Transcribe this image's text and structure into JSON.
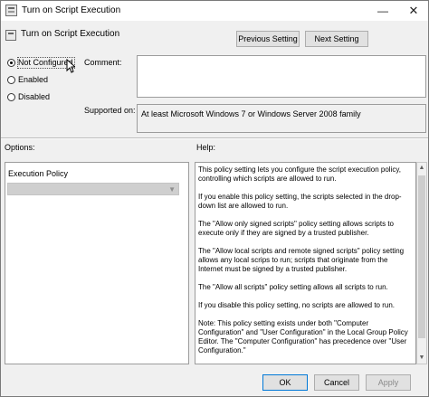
{
  "window": {
    "title": "Turn on Script Execution",
    "minimize_glyph": "—",
    "close_glyph": "✕"
  },
  "header": {
    "setting_name": "Turn on Script Execution",
    "prev_label": "Previous Setting",
    "next_label": "Next Setting"
  },
  "state": {
    "options": [
      {
        "label": "Not Configured",
        "checked": true
      },
      {
        "label": "Enabled",
        "checked": false
      },
      {
        "label": "Disabled",
        "checked": false
      }
    ]
  },
  "labels": {
    "comment": "Comment:",
    "supported_on": "Supported on:",
    "options": "Options:",
    "help": "Help:"
  },
  "supported_on_value": "At least Microsoft Windows 7 or Windows Server 2008 family",
  "options_panel": {
    "execution_policy_label": "Execution Policy",
    "execution_policy_value": ""
  },
  "help_paragraphs": [
    "This policy setting lets you configure the script execution policy, controlling which scripts are allowed to run.",
    "If you enable this policy setting, the scripts selected in the drop-down list are allowed to run.",
    "The \"Allow only signed scripts\" policy setting allows scripts to execute only if they are signed by a trusted publisher.",
    "The \"Allow local scripts and remote signed scripts\" policy setting allows any local scrips to run; scripts that originate from the Internet must be signed by a trusted publisher.",
    "The \"Allow all scripts\" policy setting allows all scripts to run.",
    "If you disable this policy setting, no scripts are allowed to run.",
    "Note: This policy setting exists under both \"Computer Configuration\" and \"User Configuration\" in the Local Group Policy Editor. The \"Computer Configuration\" has precedence over \"User Configuration.\""
  ],
  "footer": {
    "ok_label": "OK",
    "cancel_label": "Cancel",
    "apply_label": "Apply"
  },
  "icons": {
    "window": "policy-icon",
    "setting": "policy-icon",
    "cursor": "mouse-pointer-icon",
    "combo": "chevron-down-icon",
    "scroll_up": "scroll-up-arrow-icon",
    "scroll_down": "scroll-down-arrow-icon"
  },
  "colors": {
    "dialog_background": "#f0f0f0",
    "ok_border": "#0078d7"
  }
}
